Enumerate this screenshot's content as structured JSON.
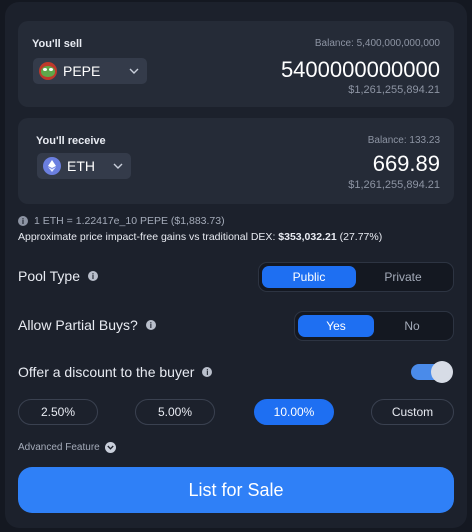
{
  "sell": {
    "label": "You'll sell",
    "balance": "Balance: 5,400,000,000,000",
    "token": "PEPE",
    "amount": "5400000000000",
    "usd": "$1,261,255,894.21"
  },
  "receive": {
    "label": "You'll receive",
    "balance": "Balance: 133.23",
    "token": "ETH",
    "amount": "669.89",
    "usd": "$1,261,255,894.21"
  },
  "rate": "1 ETH = 1.22417e_10 PEPE ($1,883.73)",
  "gains": {
    "text": "Approximate price impact-free gains vs traditional DEX: ",
    "value": "$353,032.21",
    "percent": " (27.77%)"
  },
  "pool_type": {
    "label": "Pool Type",
    "options": [
      "Public",
      "Private"
    ],
    "selected": "Public"
  },
  "partial_buys": {
    "label": "Allow Partial Buys?",
    "options": [
      "Yes",
      "No"
    ],
    "selected": "Yes"
  },
  "discount": {
    "label": "Offer a discount to the buyer",
    "enabled": true,
    "options": [
      "2.50%",
      "5.00%",
      "10.00%",
      "Custom"
    ],
    "selected": "10.00%"
  },
  "advanced_label": "Advanced Feature",
  "cta_label": "List for Sale",
  "icons": {
    "info": "info-icon",
    "chevron": "chevron-down-icon",
    "pepe": "pepe-token-icon",
    "eth": "eth-token-icon"
  },
  "colors": {
    "accent": "#1e6ff2",
    "cta": "#2f80f7",
    "background": "#141821",
    "card": "#252b37"
  }
}
